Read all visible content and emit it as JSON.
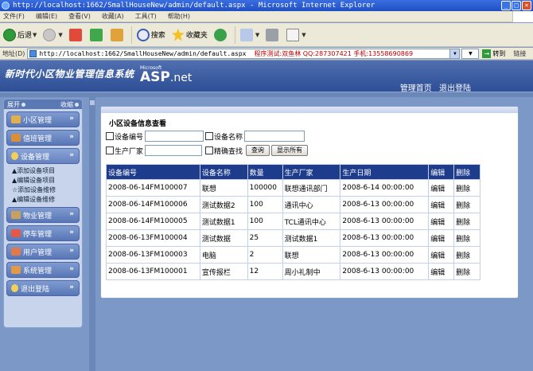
{
  "window": {
    "title": "http://localhost:1662/SmallHouseNew/admin/default.aspx - Microsoft Internet Explorer"
  },
  "menu": [
    "文件(F)",
    "编辑(E)",
    "查看(V)",
    "收藏(A)",
    "工具(T)",
    "帮助(H)"
  ],
  "toolbar": {
    "back": "后退",
    "search": "搜索",
    "favorites": "收藏夹"
  },
  "address": {
    "label": "地址(D)",
    "url": "http://localhost:1662/SmallHouseNew/admin/default.aspx",
    "note": "程序测试:双鱼林 QQ:287307421 手机:13558690869",
    "go": "转到",
    "links": "链接"
  },
  "site": {
    "title": "新时代小区物业管理信息系统",
    "logo_ms": "Microsoft",
    "logo_asp": "ASP",
    "logo_net": ".net",
    "nav_home": "管理首页",
    "nav_logout": "退出登陆"
  },
  "sidebar": {
    "expand": "展开",
    "collapse": "收缩",
    "items": [
      {
        "label": "小区管理",
        "icon": "building-icon"
      },
      {
        "label": "值班管理",
        "icon": "duty-icon"
      },
      {
        "label": "设备管理",
        "icon": "bulb-icon"
      },
      {
        "label": "物业管理",
        "icon": "property-icon"
      },
      {
        "label": "停车管理",
        "icon": "parking-icon"
      },
      {
        "label": "用户管理",
        "icon": "user-icon"
      },
      {
        "label": "系统管理",
        "icon": "system-icon"
      },
      {
        "label": "退出登陆",
        "icon": "exit-icon"
      }
    ],
    "device_sub": [
      "▲添加设备项目",
      "▲编辑设备项目",
      "☆添加设备维修",
      "▲编辑设备维修"
    ]
  },
  "panel": {
    "title": "小区设备信息查看",
    "f_device_no": "设备编号",
    "f_device_name": "设备名称",
    "f_vendor": "生产厂家",
    "f_fuzzy": "精确查找",
    "btn_query": "查询",
    "btn_show_all": "显示所有"
  },
  "table": {
    "headers": [
      "设备编号",
      "设备名称",
      "数量",
      "生产厂家",
      "生产日期",
      "编辑",
      "删除"
    ],
    "rows": [
      [
        "2008-06-14FM100007",
        "联想",
        "100000",
        "联想通讯部门",
        "2008-6-14 00:00:00",
        "编辑",
        "删除"
      ],
      [
        "2008-06-14FM100006",
        "测试数据2",
        "100",
        "通讯中心",
        "2008-6-13 00:00:00",
        "编辑",
        "删除"
      ],
      [
        "2008-06-14FM100005",
        "测试数据1",
        "100",
        "TCL通讯中心",
        "2008-6-13 00:00:00",
        "编辑",
        "删除"
      ],
      [
        "2008-06-13FM100004",
        "测试数据",
        "25",
        "测试数据1",
        "2008-6-13 00:00:00",
        "编辑",
        "删除"
      ],
      [
        "2008-06-13FM100003",
        "电脑",
        "2",
        "联想",
        "2008-6-13 00:00:00",
        "编辑",
        "删除"
      ],
      [
        "2008-06-13FM100001",
        "宣传报栏",
        "12",
        "周小礼制中",
        "2008-6-13 00:00:00",
        "编辑",
        "删除"
      ]
    ]
  }
}
